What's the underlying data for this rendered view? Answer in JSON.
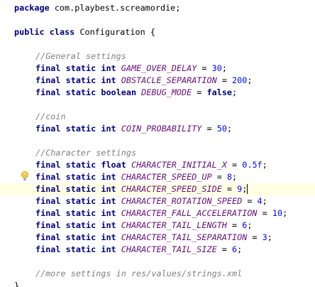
{
  "package_line": {
    "keyword": "package",
    "name": "com.playbest.screamordie",
    "end": ";"
  },
  "class_decl": {
    "kw1": "public",
    "kw2": "class",
    "name": "Configuration",
    "brace": "{"
  },
  "comments": {
    "general": "//General settings",
    "coin": "//coin",
    "character": "//Character settings",
    "more": "//more settings in res/values/strings.xml"
  },
  "fields": [
    {
      "modifiers": "final static",
      "type": "int",
      "name": "GAME_OVER_DELAY",
      "value": "30"
    },
    {
      "modifiers": "final static",
      "type": "int",
      "name": "OBSTACLE_SEPARATION",
      "value": "200"
    },
    {
      "modifiers": "final static",
      "type": "boolean",
      "name": "DEBUG_MODE",
      "value": "false"
    },
    {
      "modifiers": "final static",
      "type": "int",
      "name": "COIN_PROBABILITY",
      "value": "50"
    },
    {
      "modifiers": "final static",
      "type": "float",
      "name": "CHARACTER_INITIAL_X",
      "value": "0.5f"
    },
    {
      "modifiers": "final static",
      "type": "int",
      "name": "CHARACTER_SPEED_UP",
      "value": "8"
    },
    {
      "modifiers": "final static",
      "type": "int",
      "name": "CHARACTER_SPEED_SIDE",
      "value": "9"
    },
    {
      "modifiers": "final static",
      "type": "int",
      "name": "CHARACTER_ROTATION_SPEED",
      "value": "4"
    },
    {
      "modifiers": "final static",
      "type": "int",
      "name": "CHARACTER_FALL_ACCELERATION",
      "value": "10"
    },
    {
      "modifiers": "final static",
      "type": "int",
      "name": "CHARACTER_TAIL_LENGTH",
      "value": "6"
    },
    {
      "modifiers": "final static",
      "type": "int",
      "name": "CHARACTER_TAIL_SEPARATION",
      "value": "3"
    },
    {
      "modifiers": "final static",
      "type": "int",
      "name": "CHARACTER_TAIL_SIZE",
      "value": "6"
    }
  ],
  "closing_brace": "}",
  "icons": {
    "gutter": "lightbulb-icon"
  },
  "colors": {
    "keyword": "#000080",
    "comment": "#808080",
    "constant": "#660e7a",
    "number": "#0000ff",
    "current_line": "#ffffe4",
    "bulb": "#f2c744"
  }
}
